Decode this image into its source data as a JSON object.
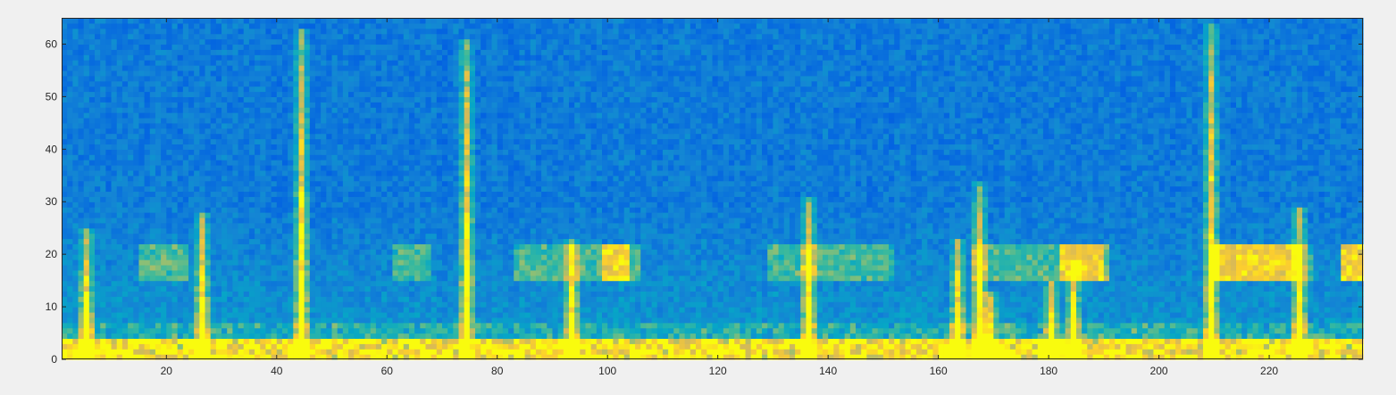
{
  "chart_data": {
    "type": "heatmap",
    "title": "",
    "xlabel": "",
    "ylabel": "",
    "xlim": [
      1,
      237
    ],
    "ylim": [
      0,
      65
    ],
    "x_ticks": [
      20,
      40,
      60,
      80,
      100,
      120,
      140,
      160,
      180,
      200,
      220
    ],
    "y_ticks": [
      0,
      10,
      20,
      30,
      40,
      50,
      60
    ],
    "x_tick_labels": [
      "20",
      "40",
      "60",
      "80",
      "100",
      "120",
      "140",
      "160",
      "180",
      "200",
      "220"
    ],
    "y_tick_labels": [
      "0",
      "10",
      "20",
      "30",
      "40",
      "50",
      "60"
    ],
    "grid": false,
    "colormap": "parula",
    "colormap_stops": [
      "#352a87",
      "#0363e1",
      "#1485d4",
      "#06a7c6",
      "#38b99e",
      "#92bf73",
      "#d9ba56",
      "#fcce2e",
      "#f9fb0e"
    ],
    "n_time_bins": 236,
    "n_freq_bins": 65,
    "background_level": 0.12,
    "band_row_range": [
      15,
      21
    ],
    "band_segments_x": [
      [
        14,
        22
      ],
      [
        60,
        66
      ],
      [
        82,
        104
      ],
      [
        128,
        150
      ],
      [
        165,
        188
      ],
      [
        208,
        226
      ],
      [
        232,
        236
      ]
    ],
    "band_peak_segments_x": [
      [
        98,
        102
      ],
      [
        181,
        189
      ],
      [
        209,
        224
      ],
      [
        232,
        236
      ]
    ],
    "bright_bursts": [
      {
        "x": 4,
        "top_freq": 24
      },
      {
        "x": 25,
        "top_freq": 27
      },
      {
        "x": 43,
        "top_freq": 62
      },
      {
        "x": 73,
        "top_freq": 60
      },
      {
        "x": 92,
        "top_freq": 22
      },
      {
        "x": 135,
        "top_freq": 30
      },
      {
        "x": 162,
        "top_freq": 22
      },
      {
        "x": 166,
        "top_freq": 33
      },
      {
        "x": 168,
        "top_freq": 12
      },
      {
        "x": 179,
        "top_freq": 14
      },
      {
        "x": 183,
        "top_freq": 18
      },
      {
        "x": 208,
        "top_freq": 63
      },
      {
        "x": 224,
        "top_freq": 28
      }
    ],
    "low_freq_bright_rows": [
      0,
      3
    ]
  }
}
